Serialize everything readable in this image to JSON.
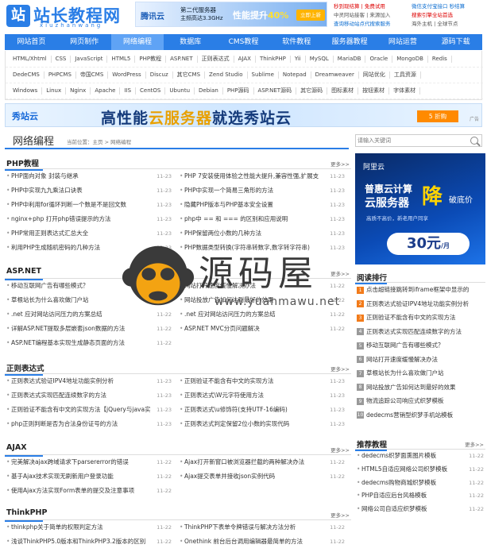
{
  "header": {
    "logo_glyph": "站",
    "logo_text": "站长教程网",
    "logo_sub": "xiuzhanwang",
    "top_banner": {
      "brand": "腾讯云",
      "line1": "第二代服务器",
      "line2": "主频高达3.3GHz",
      "main": "性能提升",
      "pct": "40%",
      "button": "立即上新"
    },
    "ads": [
      {
        "text": "秒到现结算 | 免费试用",
        "color": "#d00"
      },
      {
        "text": "微信支付宝接口 秒结算",
        "color": "#0a6cd0"
      },
      {
        "text": "中灵阿站接客 | 来源加入",
        "color": "#555"
      },
      {
        "text": "搜索引擎全站首选",
        "color": "#d00"
      },
      {
        "text": "查询移动站点代搜索服务",
        "color": "#0a6cd0"
      },
      {
        "text": "海外主机 | 全球节点",
        "color": "#555"
      }
    ]
  },
  "nav": [
    {
      "label": "网站首页",
      "active": false
    },
    {
      "label": "网页制作",
      "active": false
    },
    {
      "label": "网络编程",
      "active": true
    },
    {
      "label": "数据库",
      "active": false
    },
    {
      "label": "CMS教程",
      "active": false
    },
    {
      "label": "软件教程",
      "active": false
    },
    {
      "label": "服务器教程",
      "active": false
    },
    {
      "label": "网站运营",
      "active": false
    },
    {
      "label": "源码下载",
      "active": false
    }
  ],
  "tags": [
    [
      "HTML/Xhtml",
      "CSS",
      "JavaScript",
      "HTML5",
      "PHP教程",
      "ASP.NET",
      "正则表达式",
      "AJAX",
      "ThinkPHP",
      "Yii",
      "MySQL",
      "MariaDB",
      "Oracle",
      "MongoDB",
      "Redis"
    ],
    [
      "DedeCMS",
      "PHPCMS",
      "帝国CMS",
      "WordPress",
      "Discuz",
      "其它CMS",
      "Zend Studio",
      "Sublime",
      "Notepad",
      "Dreamweaver",
      "网站优化",
      "工具资源"
    ],
    [
      "Windows",
      "Linux",
      "Nginx",
      "Apache",
      "IIS",
      "CentOS",
      "Ubuntu",
      "Debian",
      "PHP源码",
      "ASP.NET源码",
      "其它源码",
      "图标素材",
      "按钮素材",
      "字体素材"
    ]
  ],
  "big_banner": {
    "logo": "秀站云",
    "text_pre": "高性能",
    "text_hl": "云服务器",
    "text_post": "就选秀站云",
    "button": "5 折购",
    "ad_tag": "广告"
  },
  "section": {
    "title": "网络编程",
    "crumb": "当前位置：主页 > 网络编程"
  },
  "search": {
    "placeholder": "请输入关键词"
  },
  "more_label": "更多>>",
  "blocks": [
    {
      "title": "PHP教程",
      "left": [
        {
          "t": "PHP面向对象 封装与继承",
          "d": "11-23"
        },
        {
          "t": "PHP中实现九九乘法口诀表",
          "d": "11-23"
        },
        {
          "t": "PHP中利用for循环判断一个数是不是回文数",
          "d": "11-23"
        },
        {
          "t": "nginx+php 打开php错误提示的方法",
          "d": "11-23"
        },
        {
          "t": "PHP常用正则表达式汇总大全",
          "d": "11-23"
        },
        {
          "t": "利用PHP生成随机密码的几种方法",
          "d": "11-23"
        }
      ],
      "right": [
        {
          "t": "PHP 7安装使用体验之性能大提升,兼容性强,扩展支",
          "d": "11-23"
        },
        {
          "t": "PHP中实现一个简易三角形的方法",
          "d": "11-23"
        },
        {
          "t": "隐藏PHP版本与PHP基本安全设置",
          "d": "11-23"
        },
        {
          "t": "php中 == 和 === 的区别和应用说明",
          "d": "11-23"
        },
        {
          "t": "PHP保留两位小数的几种方法",
          "d": "11-23"
        },
        {
          "t": "PHP数据类型转换(字符串转数字,数字转字符串)",
          "d": "11-23"
        }
      ]
    },
    {
      "title": "ASP.NET",
      "left": [
        {
          "t": "移动互联网广告有哪些模式？",
          "d": "11-22"
        },
        {
          "t": "草根站长为什么喜欢做门户站",
          "d": "11-22"
        },
        {
          "t": ".net 应对网站访问压力的方案总结",
          "d": "11-22"
        },
        {
          "t": "详解ASP.NET提取多层嵌套json数据的方法",
          "d": "11-22"
        },
        {
          "t": "ASP.NET编程基本实现生成静态页面的方法",
          "d": "11-22"
        }
      ],
      "right": [
        {
          "t": "网站打开速度缓慢解决办法",
          "d": "11-22"
        },
        {
          "t": "网站投放广告如何达到最好的效果",
          "d": "11-22"
        },
        {
          "t": ".net 应对网站访问压力的方案总结",
          "d": "11-22"
        },
        {
          "t": "ASP.NET MVC分页问题解决",
          "d": "11-22"
        }
      ]
    },
    {
      "title": "正则表达式",
      "left": [
        {
          "t": "正则表达式验证IPV4地址功能实例分析",
          "d": "11-23"
        },
        {
          "t": "正则表达式实现匹配连续数字的方法",
          "d": "11-23"
        },
        {
          "t": "正则验证不能含有中文的实现方法【jQuery与java实",
          "d": "11-23"
        },
        {
          "t": "php正则判断是否为合法身份证号的方法",
          "d": "11-23"
        }
      ],
      "right": [
        {
          "t": "正则验证不能含有中文的实现方法",
          "d": "11-23"
        },
        {
          "t": "正则表达式\\W元字符使用方法",
          "d": "11-23"
        },
        {
          "t": "正则表达式\\u修饰符(支持UTF-16编码)",
          "d": "11-23"
        },
        {
          "t": "正则表达式判定保留2位小数的实现代码",
          "d": "11-23"
        }
      ]
    },
    {
      "title": "AJAX",
      "left": [
        {
          "t": "完美解决ajax跨域请求下parsererror的错误",
          "d": "11-22"
        },
        {
          "t": "基于Ajax技术实现无刷新用户登录功能",
          "d": "11-22"
        },
        {
          "t": "使用Ajax方法实现Form表单的提交及注意事项",
          "d": "11-22"
        }
      ],
      "right": [
        {
          "t": "Ajax打开新窗口被浏览器拦截的两种解决办法",
          "d": "11-22"
        },
        {
          "t": "Ajax提交表单并接收json实例代码",
          "d": "11-22"
        }
      ]
    },
    {
      "title": "ThinkPHP",
      "left": [
        {
          "t": "thinkphp关于简单的权限判定方法",
          "d": "11-22"
        },
        {
          "t": "浅谈ThinkPHP5.0版本和ThinkPHP3.2版本的区别",
          "d": "11-22"
        }
      ],
      "right": [
        {
          "t": "ThinkPHP下表单令牌错误与解决方法分析",
          "d": "11-22"
        },
        {
          "t": "Onethink 前台后台调用编辑器最简单的方法",
          "d": "11-22"
        }
      ]
    }
  ],
  "side_ad": {
    "logo": "阿里云",
    "line1": "普惠云计算",
    "line2": "云服务器",
    "jiang": "降",
    "po": "破底价",
    "small": "高质不高价，新老用户同享",
    "price": "30元",
    "price_unit": "/月"
  },
  "ranking": {
    "title": "阅读排行",
    "items": [
      "点击超链接跳转到iframe框架中显示的",
      "正则表达式验证IPV4地址功能实例分析",
      "正则验证不能含有中文的实现方法",
      "正则表达式实现匹配连续数字的方法",
      "移动互联网广告有哪些模式？",
      "网站打开速度缓慢解决办法",
      "草根站长为什么喜欢做门户站",
      "网站投放广告如何达到最好的效果",
      "物流追踪公司响应式织梦模板",
      "dedecms营销型织梦手机站模板"
    ]
  },
  "recommend": {
    "title": "推荐教程",
    "items": [
      {
        "t": "dedecms织梦面熏图片模板",
        "d": "11-22"
      },
      {
        "t": "HTML5自适应网络公司织梦模板",
        "d": "11-22"
      },
      {
        "t": "dedecms购物商城织梦模板",
        "d": "11-22"
      },
      {
        "t": "PHP自适应后台风格模板",
        "d": "11-22"
      },
      {
        "t": "网络公司自适应织梦模板",
        "d": "11-22"
      }
    ]
  },
  "watermark": {
    "text": "源码屋",
    "url": "www.yuanmawu.net"
  }
}
